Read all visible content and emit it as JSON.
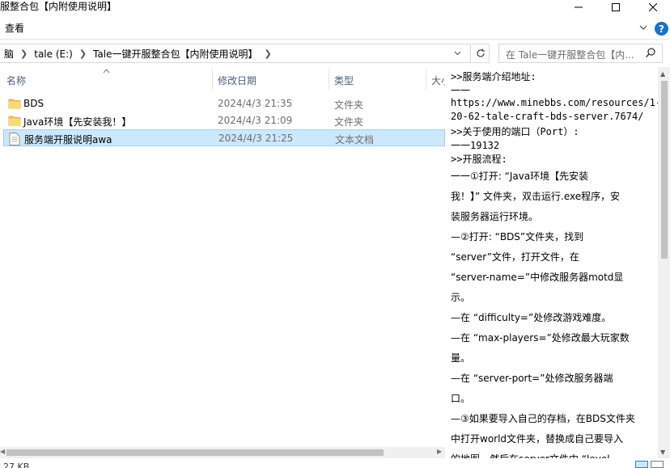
{
  "window": {
    "title": "服整合包【内附使用说明】",
    "minimize_glyph": "—",
    "maximize_glyph": "☐",
    "close_glyph": "✕"
  },
  "ribbon": {
    "view_tab": "查看",
    "help_label": "?"
  },
  "address": {
    "crumbs": [
      "脑",
      "tale (E:)",
      "Tale一键开服整合包【内附使用说明】"
    ],
    "search_placeholder": "在 Tale一键开服整合包【内..."
  },
  "columns": {
    "name": "名称",
    "date": "修改日期",
    "type": "类型",
    "size": "大小"
  },
  "files": [
    {
      "name": "BDS",
      "date": "2024/4/3 21:35",
      "type": "文件夹",
      "icon": "folder-icon"
    },
    {
      "name": "Java环境【先安装我！】",
      "date": "2024/4/3 21:09",
      "type": "文件夹",
      "icon": "folder-icon"
    },
    {
      "name": "服务端开服说明awa",
      "date": "2024/4/3 21:25",
      "type": "文本文档",
      "icon": "text-file-icon"
    }
  ],
  "status": {
    "text": "27 KB"
  },
  "preview": {
    "lines": [
      ">>服务端介绍地址:",
      "一一",
      "https://www.minebbs.com/resources/1-",
      "20-62-tale-craft-bds-server.7674/",
      ">>关于使用的端口（Port）:",
      "一一19132",
      ">>开服流程:",
      "一一①打开: “Java环境【先安装",
      "我！】” 文件夹，双击运行.exe程序，安",
      "装服务器运行环境。",
      "—②打开: “BDS”文件夹，找到",
      "“server”文件，打开文件，在",
      "“server-name=”中修改服务器motd显",
      "示。",
      "—在 “difficulty=”处修改游戏难度。",
      "—在 “max-players=”处修改最大玩家数",
      "量。",
      "—在 “server-port=”处修改服务器端",
      "口。",
      "—③如果要导入自己的存档，在BDS文件夹",
      "中打开world文件夹，替换成自己要导入",
      "的地图，然后在server文件中 “level-"
    ]
  },
  "colors": {
    "selection": "#cce8ff",
    "header_text": "#4c607a",
    "help_blue": "#1a73c8"
  }
}
